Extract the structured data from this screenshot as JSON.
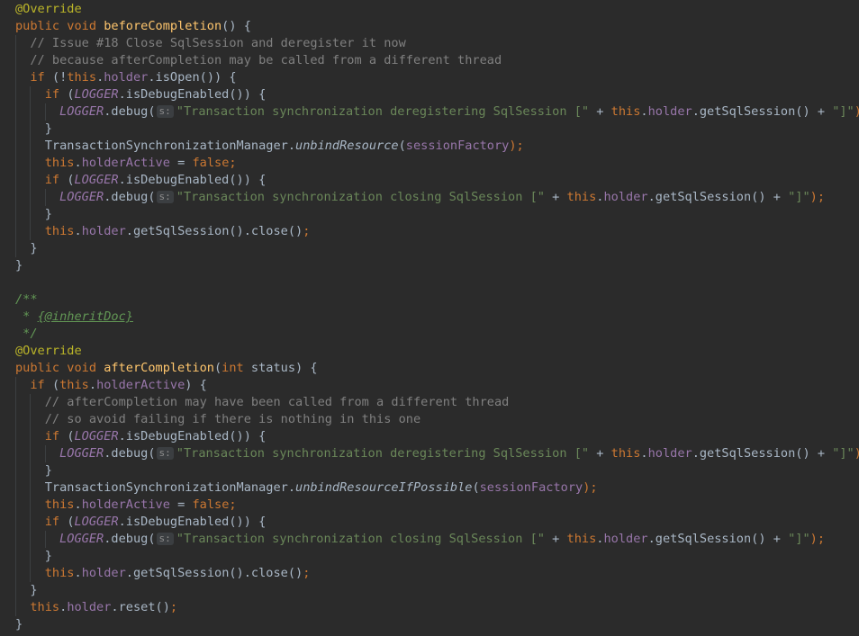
{
  "code_lines": [
    {
      "indent": 0,
      "tokens": [
        {
          "t": "@Override",
          "c": "ann"
        }
      ]
    },
    {
      "indent": 0,
      "tokens": [
        {
          "t": "public void ",
          "c": "kw"
        },
        {
          "t": "beforeCompletion",
          "c": "mth"
        },
        {
          "t": "() {",
          "c": "pun"
        }
      ]
    },
    {
      "indent": 1,
      "tokens": [
        {
          "t": "// Issue #18 Close SqlSession and deregister it now",
          "c": "cmt"
        }
      ]
    },
    {
      "indent": 1,
      "tokens": [
        {
          "t": "// because afterCompletion may be called from a different thread",
          "c": "cmt"
        }
      ]
    },
    {
      "indent": 1,
      "tokens": [
        {
          "t": "if ",
          "c": "kw"
        },
        {
          "t": "(!",
          "c": "pun"
        },
        {
          "t": "this",
          "c": "kw"
        },
        {
          "t": ".",
          "c": "pun"
        },
        {
          "t": "holder",
          "c": "fld"
        },
        {
          "t": ".isOpen()) {",
          "c": "pun"
        }
      ]
    },
    {
      "indent": 2,
      "tokens": [
        {
          "t": "if ",
          "c": "kw"
        },
        {
          "t": "(",
          "c": "pun"
        },
        {
          "t": "LOGGER",
          "c": "static"
        },
        {
          "t": ".isDebugEnabled()) {",
          "c": "pun"
        }
      ]
    },
    {
      "indent": 3,
      "tokens": [
        {
          "t": "LOGGER",
          "c": "static"
        },
        {
          "t": ".debug(",
          "c": "pun"
        },
        {
          "t": "s:",
          "c": "hint"
        },
        {
          "t": "\"Transaction synchronization deregistering SqlSession [\"",
          "c": "str"
        },
        {
          "t": " + ",
          "c": "pun"
        },
        {
          "t": "this",
          "c": "kw"
        },
        {
          "t": ".",
          "c": "pun"
        },
        {
          "t": "holder",
          "c": "fld"
        },
        {
          "t": ".getSqlSession() + ",
          "c": "pun"
        },
        {
          "t": "\"]\"",
          "c": "str"
        },
        {
          "t": ");",
          "c": "kw"
        }
      ]
    },
    {
      "indent": 2,
      "tokens": [
        {
          "t": "}",
          "c": "pun"
        }
      ]
    },
    {
      "indent": 2,
      "tokens": [
        {
          "t": "TransactionSynchronizationManager.",
          "c": "pun"
        },
        {
          "t": "unbindResource",
          "c": "smeth"
        },
        {
          "t": "(",
          "c": "pun"
        },
        {
          "t": "sessionFactory",
          "c": "fld"
        },
        {
          "t": ");",
          "c": "kw"
        }
      ]
    },
    {
      "indent": 2,
      "tokens": [
        {
          "t": "this",
          "c": "kw"
        },
        {
          "t": ".",
          "c": "pun"
        },
        {
          "t": "holderActive",
          "c": "fld"
        },
        {
          "t": " = ",
          "c": "pun"
        },
        {
          "t": "false;",
          "c": "kw"
        }
      ]
    },
    {
      "indent": 2,
      "tokens": [
        {
          "t": "if ",
          "c": "kw"
        },
        {
          "t": "(",
          "c": "pun"
        },
        {
          "t": "LOGGER",
          "c": "static"
        },
        {
          "t": ".isDebugEnabled()) {",
          "c": "pun"
        }
      ]
    },
    {
      "indent": 3,
      "tokens": [
        {
          "t": "LOGGER",
          "c": "static"
        },
        {
          "t": ".debug(",
          "c": "pun"
        },
        {
          "t": "s:",
          "c": "hint"
        },
        {
          "t": "\"Transaction synchronization closing SqlSession [\"",
          "c": "str"
        },
        {
          "t": " + ",
          "c": "pun"
        },
        {
          "t": "this",
          "c": "kw"
        },
        {
          "t": ".",
          "c": "pun"
        },
        {
          "t": "holder",
          "c": "fld"
        },
        {
          "t": ".getSqlSession() + ",
          "c": "pun"
        },
        {
          "t": "\"]\"",
          "c": "str"
        },
        {
          "t": ");",
          "c": "kw"
        }
      ]
    },
    {
      "indent": 2,
      "tokens": [
        {
          "t": "}",
          "c": "pun"
        }
      ]
    },
    {
      "indent": 2,
      "tokens": [
        {
          "t": "this",
          "c": "kw"
        },
        {
          "t": ".",
          "c": "pun"
        },
        {
          "t": "holder",
          "c": "fld"
        },
        {
          "t": ".getSqlSession().close()",
          "c": "pun"
        },
        {
          "t": ";",
          "c": "kw"
        }
      ]
    },
    {
      "indent": 1,
      "tokens": [
        {
          "t": "}",
          "c": "pun"
        }
      ]
    },
    {
      "indent": 0,
      "tokens": [
        {
          "t": "}",
          "c": "pun"
        }
      ]
    },
    {
      "indent": 0,
      "tokens": []
    },
    {
      "indent": 0,
      "tokens": [
        {
          "t": "/**",
          "c": "doc"
        }
      ]
    },
    {
      "indent": 0,
      "tokens": [
        {
          "t": " * ",
          "c": "doc"
        },
        {
          "t": "{@inheritDoc}",
          "c": "doctag"
        }
      ]
    },
    {
      "indent": 0,
      "tokens": [
        {
          "t": " */",
          "c": "doc"
        }
      ]
    },
    {
      "indent": 0,
      "tokens": [
        {
          "t": "@Override",
          "c": "ann"
        }
      ]
    },
    {
      "indent": 0,
      "tokens": [
        {
          "t": "public void ",
          "c": "kw"
        },
        {
          "t": "afterCompletion",
          "c": "mth"
        },
        {
          "t": "(",
          "c": "pun"
        },
        {
          "t": "int ",
          "c": "kw"
        },
        {
          "t": "status) {",
          "c": "pun"
        }
      ]
    },
    {
      "indent": 1,
      "tokens": [
        {
          "t": "if ",
          "c": "kw"
        },
        {
          "t": "(",
          "c": "pun"
        },
        {
          "t": "this",
          "c": "kw"
        },
        {
          "t": ".",
          "c": "pun"
        },
        {
          "t": "holderActive",
          "c": "fld"
        },
        {
          "t": ") {",
          "c": "pun"
        }
      ]
    },
    {
      "indent": 2,
      "tokens": [
        {
          "t": "// afterCompletion may have been called from a different thread",
          "c": "cmt"
        }
      ]
    },
    {
      "indent": 2,
      "tokens": [
        {
          "t": "// so avoid failing if there is nothing in this one",
          "c": "cmt"
        }
      ]
    },
    {
      "indent": 2,
      "tokens": [
        {
          "t": "if ",
          "c": "kw"
        },
        {
          "t": "(",
          "c": "pun"
        },
        {
          "t": "LOGGER",
          "c": "static"
        },
        {
          "t": ".isDebugEnabled()) {",
          "c": "pun"
        }
      ]
    },
    {
      "indent": 3,
      "tokens": [
        {
          "t": "LOGGER",
          "c": "static"
        },
        {
          "t": ".debug(",
          "c": "pun"
        },
        {
          "t": "s:",
          "c": "hint"
        },
        {
          "t": "\"Transaction synchronization deregistering SqlSession [\"",
          "c": "str"
        },
        {
          "t": " + ",
          "c": "pun"
        },
        {
          "t": "this",
          "c": "kw"
        },
        {
          "t": ".",
          "c": "pun"
        },
        {
          "t": "holder",
          "c": "fld"
        },
        {
          "t": ".getSqlSession() + ",
          "c": "pun"
        },
        {
          "t": "\"]\"",
          "c": "str"
        },
        {
          "t": ");",
          "c": "kw"
        }
      ]
    },
    {
      "indent": 2,
      "tokens": [
        {
          "t": "}",
          "c": "pun"
        }
      ]
    },
    {
      "indent": 2,
      "tokens": [
        {
          "t": "TransactionSynchronizationManager.",
          "c": "pun"
        },
        {
          "t": "unbindResourceIfPossible",
          "c": "smeth"
        },
        {
          "t": "(",
          "c": "pun"
        },
        {
          "t": "sessionFactory",
          "c": "fld"
        },
        {
          "t": ");",
          "c": "kw"
        }
      ]
    },
    {
      "indent": 2,
      "tokens": [
        {
          "t": "this",
          "c": "kw"
        },
        {
          "t": ".",
          "c": "pun"
        },
        {
          "t": "holderActive",
          "c": "fld"
        },
        {
          "t": " = ",
          "c": "pun"
        },
        {
          "t": "false;",
          "c": "kw"
        }
      ]
    },
    {
      "indent": 2,
      "tokens": [
        {
          "t": "if ",
          "c": "kw"
        },
        {
          "t": "(",
          "c": "pun"
        },
        {
          "t": "LOGGER",
          "c": "static"
        },
        {
          "t": ".isDebugEnabled()) {",
          "c": "pun"
        }
      ]
    },
    {
      "indent": 3,
      "tokens": [
        {
          "t": "LOGGER",
          "c": "static"
        },
        {
          "t": ".debug(",
          "c": "pun"
        },
        {
          "t": "s:",
          "c": "hint"
        },
        {
          "t": "\"Transaction synchronization closing SqlSession [\"",
          "c": "str"
        },
        {
          "t": " + ",
          "c": "pun"
        },
        {
          "t": "this",
          "c": "kw"
        },
        {
          "t": ".",
          "c": "pun"
        },
        {
          "t": "holder",
          "c": "fld"
        },
        {
          "t": ".getSqlSession() + ",
          "c": "pun"
        },
        {
          "t": "\"]\"",
          "c": "str"
        },
        {
          "t": ");",
          "c": "kw"
        }
      ]
    },
    {
      "indent": 2,
      "tokens": [
        {
          "t": "}",
          "c": "pun"
        }
      ]
    },
    {
      "indent": 2,
      "tokens": [
        {
          "t": "this",
          "c": "kw"
        },
        {
          "t": ".",
          "c": "pun"
        },
        {
          "t": "holder",
          "c": "fld"
        },
        {
          "t": ".getSqlSession().close()",
          "c": "pun"
        },
        {
          "t": ";",
          "c": "kw"
        }
      ]
    },
    {
      "indent": 1,
      "tokens": [
        {
          "t": "}",
          "c": "pun"
        }
      ]
    },
    {
      "indent": 1,
      "tokens": [
        {
          "t": "this",
          "c": "kw"
        },
        {
          "t": ".",
          "c": "pun"
        },
        {
          "t": "holder",
          "c": "fld"
        },
        {
          "t": ".reset()",
          "c": "pun"
        },
        {
          "t": ";",
          "c": "kw"
        }
      ]
    },
    {
      "indent": 0,
      "tokens": [
        {
          "t": "}",
          "c": "pun"
        }
      ]
    }
  ],
  "colors": {
    "background": "#2b2b2b",
    "keyword": "#cc7832",
    "annotation": "#bbb529",
    "method_declaration": "#ffc66d",
    "field": "#9876aa",
    "string": "#6a8759",
    "comment": "#808080",
    "doc_comment": "#629755",
    "default_text": "#a9b7c6"
  }
}
